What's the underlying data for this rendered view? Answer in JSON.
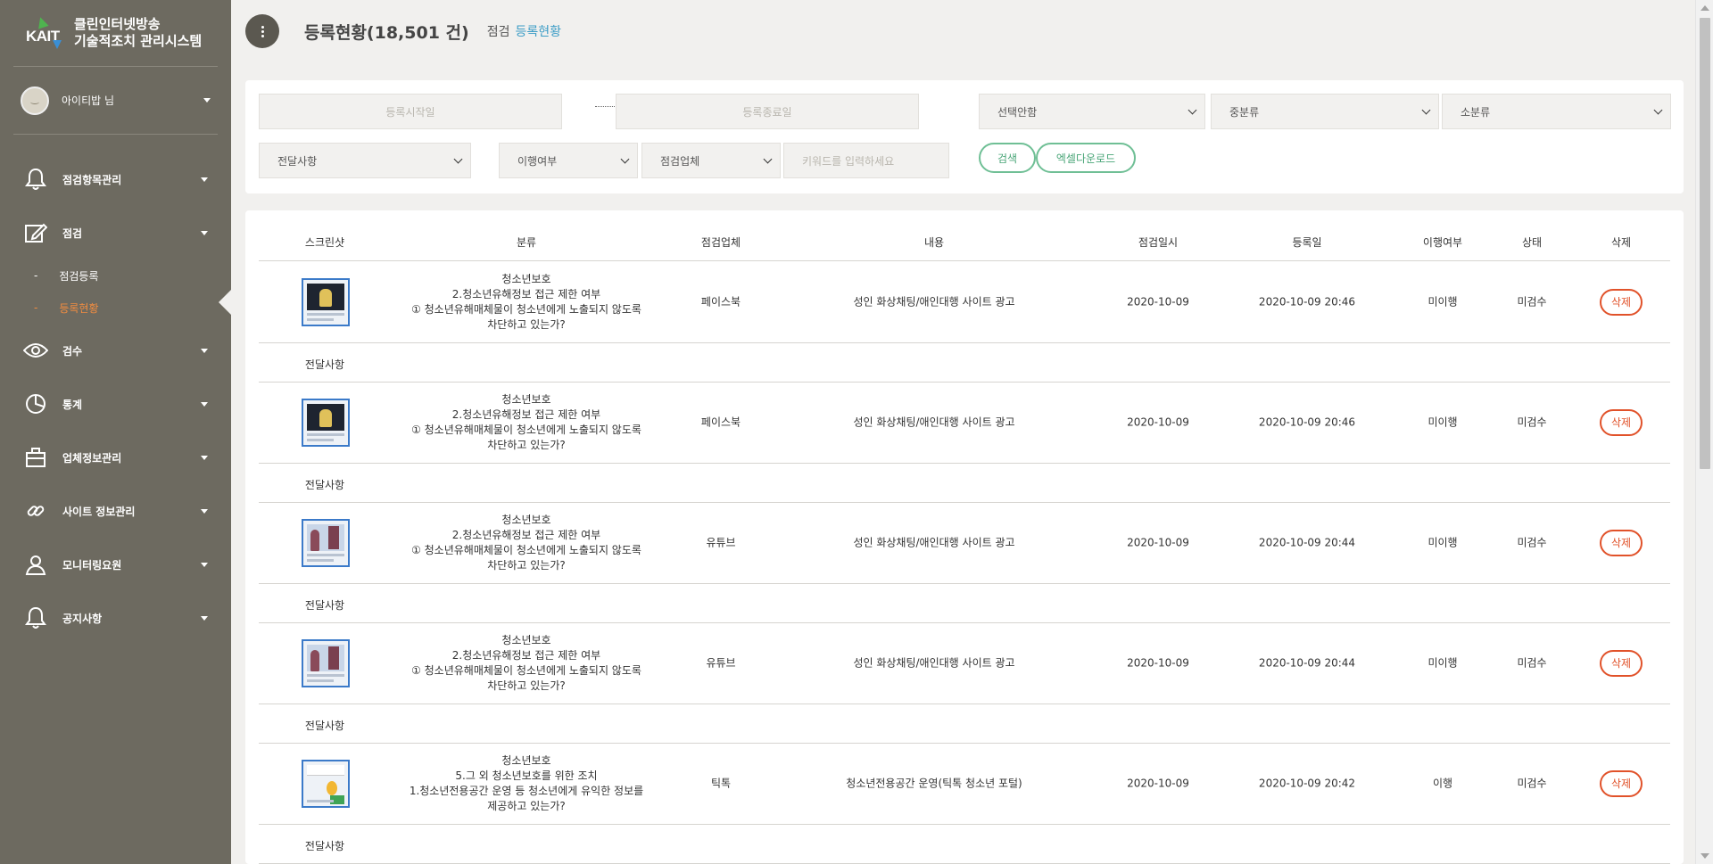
{
  "brand": {
    "logo_text": "KAIT",
    "title_line1": "클린인터넷방송",
    "title_line2": "기술적조치 관리시스템"
  },
  "user": {
    "name": "아이티밥 님"
  },
  "menu": {
    "m1": "점검항목관리",
    "m2": "점검",
    "sub1": "점검등록",
    "sub2": "등록현황",
    "m3": "검수",
    "m4": "통계",
    "m5": "업체정보관리",
    "m6": "사이트 정보관리",
    "m7": "모니터링요원",
    "m8": "공지사항"
  },
  "header": {
    "title": "등록현황(18,501 건)",
    "crumb1": "점검",
    "crumb2": "등록현황"
  },
  "filters": {
    "start_placeholder": "등록시작일",
    "end_placeholder": "등록종료일",
    "category_large": "선택안함",
    "category_mid": "중분류",
    "category_small": "소분류",
    "notice": "전달사항",
    "fulfill": "이행여부",
    "company": "점검업체",
    "keyword_placeholder": "키워드를 입력하세요",
    "search_label": "검색",
    "excel_label": "엑셀다운로드"
  },
  "table": {
    "headers": {
      "screenshot": "스크린샷",
      "category": "분류",
      "company": "점검업체",
      "content": "내용",
      "date": "점검일시",
      "reg": "등록일",
      "fulfill": "이행여부",
      "status": "상태",
      "delete": "삭제"
    },
    "note_label": "전달사항",
    "delete_label": "삭제",
    "rows": [
      {
        "cat1": "청소년보호",
        "cat2": "2.청소년유해정보 접근 제한 여부",
        "cat3": "① 청소년유해매체물이 청소년에게 노출되지 않도록",
        "cat4": "차단하고 있는가?",
        "company": "페이스북",
        "content": "성인 화상채팅/애인대행 사이트 광고",
        "date": "2020-10-09",
        "reg": "2020-10-09 20:46",
        "fulfill": "미이행",
        "status": "미검수"
      },
      {
        "cat1": "청소년보호",
        "cat2": "2.청소년유해정보 접근 제한 여부",
        "cat3": "① 청소년유해매체물이 청소년에게 노출되지 않도록",
        "cat4": "차단하고 있는가?",
        "company": "페이스북",
        "content": "성인 화상채팅/애인대행 사이트 광고",
        "date": "2020-10-09",
        "reg": "2020-10-09 20:46",
        "fulfill": "미이행",
        "status": "미검수"
      },
      {
        "cat1": "청소년보호",
        "cat2": "2.청소년유해정보 접근 제한 여부",
        "cat3": "① 청소년유해매체물이 청소년에게 노출되지 않도록",
        "cat4": "차단하고 있는가?",
        "company": "유튜브",
        "content": "성인 화상채팅/애인대행 사이트 광고",
        "date": "2020-10-09",
        "reg": "2020-10-09 20:44",
        "fulfill": "미이행",
        "status": "미검수"
      },
      {
        "cat1": "청소년보호",
        "cat2": "2.청소년유해정보 접근 제한 여부",
        "cat3": "① 청소년유해매체물이 청소년에게 노출되지 않도록",
        "cat4": "차단하고 있는가?",
        "company": "유튜브",
        "content": "성인 화상채팅/애인대행 사이트 광고",
        "date": "2020-10-09",
        "reg": "2020-10-09 20:44",
        "fulfill": "미이행",
        "status": "미검수"
      },
      {
        "cat1": "청소년보호",
        "cat2": "5.그 외 청소년보호를 위한 조치",
        "cat3": "1.청소년전용공간 운영 등 청소년에게 유익한 정보를",
        "cat4": "제공하고 있는가?",
        "company": "틱톡",
        "content": "청소년전용공간 운영(틱톡 청소년 포털)",
        "date": "2020-10-09",
        "reg": "2020-10-09 20:42",
        "fulfill": "이행",
        "status": "미검수"
      }
    ]
  }
}
